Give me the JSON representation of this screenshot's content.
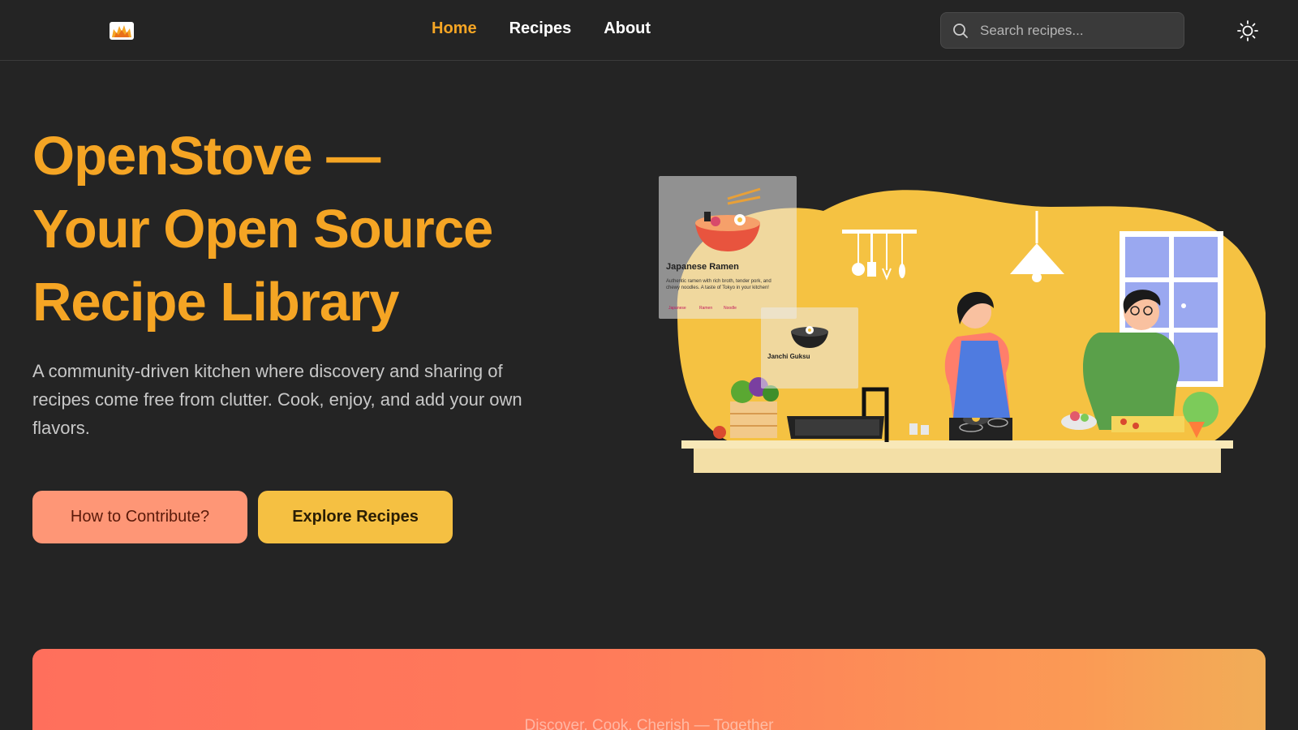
{
  "nav": {
    "items": [
      {
        "label": "Home",
        "active": true
      },
      {
        "label": "Recipes",
        "active": false
      },
      {
        "label": "About",
        "active": false
      }
    ]
  },
  "search": {
    "placeholder": "Search recipes..."
  },
  "icons": {
    "logo": "stove-flame-logo",
    "search": "search-icon",
    "theme": "sun-icon"
  },
  "hero": {
    "title_line1": "OpenStove —",
    "title_line2": "Your Open Source",
    "title_line3": "Recipe Library",
    "subtitle": "A community-driven kitchen where discovery and sharing of recipes come free from clutter. Cook, enjoy, and add your own flavors.",
    "contribute_label": "How to Contribute?",
    "explore_label": "Explore Recipes"
  },
  "illustration": {
    "card1": {
      "title": "Japanese Ramen",
      "desc": "Authentic ramen with rich broth, tender pork, and chewy noodles. A taste of Tokyo in your kitchen!",
      "tags": [
        "Japanese",
        "Ramen",
        "Noodle"
      ]
    },
    "card2": {
      "title": "Janchi Guksu"
    }
  },
  "banner": {
    "text": "Discover. Cook. Cherish — Together"
  },
  "colors": {
    "accent": "#f5a524",
    "background": "#242424",
    "contribute_button": "#fe9676",
    "explore_button": "#f5c042",
    "blob": "#f5c242"
  }
}
